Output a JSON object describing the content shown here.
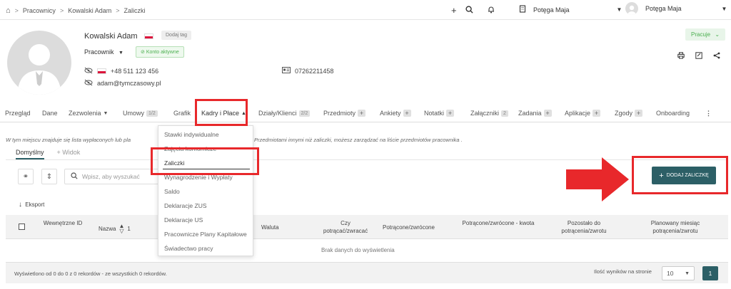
{
  "breadcrumb": {
    "items": [
      "Pracownicy",
      "Kowalski Adam",
      "Zaliczki"
    ]
  },
  "topbar": {
    "company": "Potęga Maja",
    "user": "Potęga Maja"
  },
  "profile": {
    "name": "Kowalski Adam",
    "tag_button": "Dodaj tag",
    "role": "Pracownik",
    "account_status": "Konto aktywne",
    "phone": "+48 511 123 456",
    "email": "adam@tymczasowy.pl",
    "id_number": "07262211458",
    "work_status": "Pracuje"
  },
  "tabs": [
    {
      "label": "Przegląd"
    },
    {
      "label": "Dane"
    },
    {
      "label": "Zezwolenia"
    },
    {
      "label": "Umowy",
      "badge": "1/2"
    },
    {
      "label": "Grafik"
    },
    {
      "label": "Kadry i Płace"
    },
    {
      "label": "Działy/Klienci",
      "badge": "2/2"
    },
    {
      "label": "Przedmioty"
    },
    {
      "label": "Ankiety"
    },
    {
      "label": "Notatki"
    },
    {
      "label": "Załączniki",
      "badge": "2"
    },
    {
      "label": "Zadania"
    },
    {
      "label": "Aplikacje"
    },
    {
      "label": "Zgody"
    },
    {
      "label": "Onboarding"
    }
  ],
  "info_text_left": "W tym miejscu znajduje się lista wypłaconych lub pla",
  "info_text_right": "Przedmiotami innymi niż zaliczki, możesz zarządzać na liście przedmiotów pracownika .",
  "views": {
    "default": "Domyślny",
    "add": "+ Widok"
  },
  "search": {
    "placeholder": "Wpisz, aby wyszukać"
  },
  "export_label": "Eksport",
  "add_button": "DODAJ ZALICZKĘ",
  "dropdown": {
    "items": [
      "Stawki indywidualne",
      "Zajęcia komornicze",
      "Zaliczki",
      "Wynagrodzenie i Wypłaty",
      "Saldo",
      "Deklaracje ZUS",
      "Deklaracje US",
      "Pracownicze Plany Kapitałowe",
      "Świadectwo pracy"
    ]
  },
  "table": {
    "headers": [
      "Wewnętrzne ID",
      "Nazwa",
      "Waluta",
      "Czy potrącać/zwracać",
      "Potrącone/zwrócone",
      "Potrącone/zwrócone - kwota",
      "Pozostało do potrącenia/zwrotu",
      "Planowany miesiąc potrącenia/zwrotu"
    ],
    "sort_index": "1",
    "empty": "Brak danych do wyświetlenia"
  },
  "footer": {
    "summary": "Wyświetlono od 0 do 0 z 0 rekordów - ze wszystkich 0 rekordów.",
    "page_size_label": "Ilość wyników na stronie",
    "page_size": "10",
    "page": "1"
  },
  "colors": {
    "accent": "#2c5f66",
    "highlight": "#e8282b",
    "success": "#4caf50"
  }
}
